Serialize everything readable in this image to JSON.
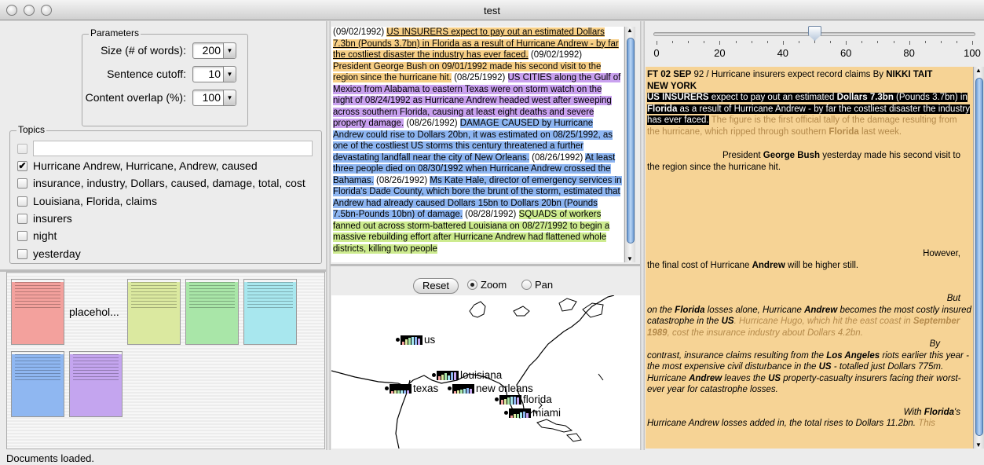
{
  "window": {
    "title": "test"
  },
  "parameters": {
    "legend": "Parameters",
    "rows": [
      {
        "label": "Size (# of words):",
        "value": "200"
      },
      {
        "label": "Sentence cutoff:",
        "value": "10"
      },
      {
        "label": "Content overlap (%):",
        "value": "100"
      }
    ]
  },
  "topics": {
    "legend": "Topics",
    "search_value": "",
    "items": [
      {
        "label": "Hurricane Andrew, Hurricane, Andrew, caused",
        "checked": true
      },
      {
        "label": "insurance, industry, Dollars, caused, damage, total, cost",
        "checked": false
      },
      {
        "label": "Louisiana, Florida, claims",
        "checked": false
      },
      {
        "label": "insurers",
        "checked": false
      },
      {
        "label": "night",
        "checked": false
      },
      {
        "label": "yesterday",
        "checked": false
      }
    ]
  },
  "thumbnails": {
    "placeholder_label": "placehol...",
    "colors": [
      "#f3a19d",
      "#dbe9a0",
      "#a9e6a8",
      "#a8e7ee",
      "#8fb7f1",
      "#c4a5ef"
    ]
  },
  "doc_text": {
    "segments": [
      {
        "date": "(09/02/1992)",
        "text": "US INSURERS expect to pay out an estimated Dollars 7.3bn (Pounds 3.7bn) in Florida as a result of Hurricane Andrew - by far the costliest disaster the industry has ever faced.",
        "color": "#f7cf86",
        "underline": true
      },
      {
        "date": "(09/02/1992)",
        "text": "President George Bush on 09/01/1992 made his second visit to the region since the hurricane hit.",
        "color": "#f7cf86",
        "underline": false
      },
      {
        "date": "(08/25/1992)",
        "text": "US CITIES along the Gulf of Mexico from Alabama to eastern Texas were on storm watch on the night of 08/24/1992 as Hurricane Andrew headed west after sweeping across southern Florida, causing at least eight deaths and severe property damage.",
        "color": "#c9a1ef",
        "underline": false
      },
      {
        "date": "(08/26/1992)",
        "text": "DAMAGE CAUSED by Hurricane Andrew could rise to Dollars 20bn, it was estimated on 08/25/1992, as one of the costliest US storms this century threatened a further devastating landfall near the city of New Orleans.",
        "color": "#8db5f1",
        "underline": false
      },
      {
        "date": "(08/26/1992)",
        "text": "At least three people died on 08/30/1992 when Hurricane Andrew crossed the Bahamas.",
        "color": "#8db5f1",
        "underline": false
      },
      {
        "date": "(08/26/1992)",
        "text": "Ms Kate Hale, director of emergency services in Florida's Dade County, which bore the brunt of the storm, estimated that Andrew had already caused Dollars 15bn to Dollars 20bn (Pounds 7.5bn-Pounds 10bn) of damage.",
        "color": "#8db5f1",
        "underline": false
      },
      {
        "date": "(08/28/1992)",
        "text": "SQUADS of workers fanned out across storm-battered Louisiana on 08/27/1992 to begin a massive rebuilding effort after Hurricane Andrew had flattened whole districts, killing two people",
        "color": "#cdeb8f",
        "underline": false
      }
    ]
  },
  "map_controls": {
    "reset_label": "Reset",
    "zoom_label": "Zoom",
    "pan_label": "Pan",
    "mode": "zoom"
  },
  "map_pins": [
    {
      "label": "us"
    },
    {
      "label": "louisiana"
    },
    {
      "label": "texas"
    },
    {
      "label": "new orleans"
    },
    {
      "label": "florida"
    },
    {
      "label": "miami"
    }
  ],
  "timeline": {
    "ticks": [
      "0",
      "20",
      "40",
      "60",
      "80",
      "100"
    ],
    "value_percent": 50
  },
  "reader": {
    "header_pre": "FT 02 SEP",
    "header_mid": " 92 / Hurricane insurers expect record claims By ",
    "author": "NIKKI TAIT",
    "place": "NEW YORK",
    "hl": [
      "US INSURERS",
      " expect to pay out an estimated ",
      "Dollars 7.3bn",
      " (Pounds 3.7bn) in ",
      "Florida",
      " as a result of Hurricane Andrew - by far the costliest disaster the industry has ever faced."
    ],
    "faded1": " The figure is the first official tally of the damage resulting from the hurricane, which ripped through southern ",
    "faded1_bold": "Florida",
    "faded1_end": " last week.",
    "p2_pre": "President ",
    "p2_bold": "George Bush",
    "p2_end": " yesterday made his second visit to the region since the hurricane hit.",
    "p3_a": "However,",
    "p3_b": "the final cost of Hurricane ",
    "p3_bold": "Andrew",
    "p3_c": " will be higher still.",
    "p4_a": "But",
    "p4_b": "on the ",
    "p4_florida": "Florida",
    "p4_c": " losses alone, Hurricane ",
    "p4_andrew": "Andrew",
    "p4_d": " becomes the most costly insured catastrophe in the ",
    "p4_us": "US",
    "p4_e": ". Hurricane Hugo, which hit the east coast in ",
    "p4_sept": "September 1989",
    "p4_f": ", cost the insurance industry about Dollars 4.2bn.",
    "p5_a": "By",
    "p5_b": "contrast, insurance claims resulting from the ",
    "p5_la": "Los Angeles",
    "p5_c": " riots earlier this year - the most expensive civil disturbance in the ",
    "p5_us": "US",
    "p5_d": " - totalled just Dollars 775m. Hurricane ",
    "p5_andrew": "Andrew",
    "p5_e": " leaves the ",
    "p5_us2": "US",
    "p5_f": " property-casualty insurers facing their worst-ever year for catastrophe losses.",
    "p6_a": "With ",
    "p6_florida": "Florida",
    "p6_b": "'s",
    "p6_c": "Hurricane Andrew losses added in, the total rises to Dollars 11.2bn.",
    "p6_d": " This"
  },
  "status": {
    "text": "Documents loaded."
  },
  "colors": {
    "accent": "#4a74a8",
    "reader_bg": "#f6d395"
  }
}
